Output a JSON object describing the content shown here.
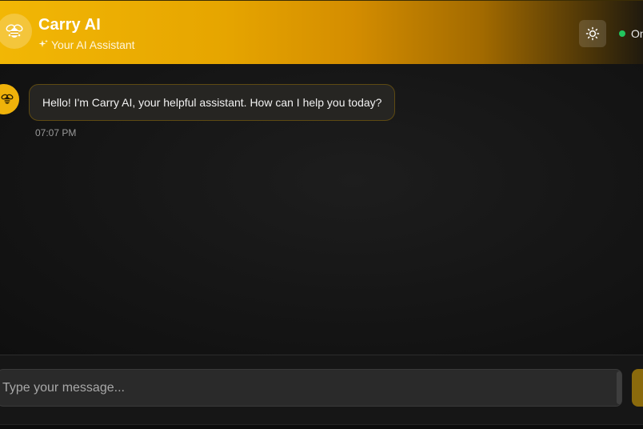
{
  "header": {
    "title": "Carry AI",
    "subtitle": "Your AI Assistant",
    "status_text": "Online",
    "logo_icon": "bee-icon",
    "theme_icon": "sun-icon",
    "colors": {
      "gradient_start": "#f2b705",
      "gradient_end": "#201a0e",
      "status": "#22c55e"
    }
  },
  "messages": [
    {
      "sender": "bot",
      "avatar_icon": "bee-icon",
      "text": "Hello! I'm Carry AI, your helpful assistant. How can I help you today?",
      "time": "07:07 PM"
    }
  ],
  "composer": {
    "placeholder": "Type your message...",
    "value": "",
    "send_icon": "send-icon"
  }
}
